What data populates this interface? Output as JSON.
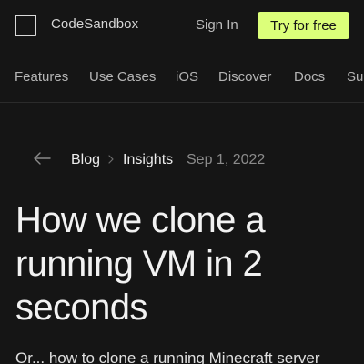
{
  "header": {
    "brand": "CodeSandbox",
    "sign_in": "Sign In",
    "cta": "Try for free",
    "accent": "#dcff7a"
  },
  "nav": {
    "items": [
      {
        "label": "Features"
      },
      {
        "label": "Use Cases"
      },
      {
        "label": "iOS"
      },
      {
        "label": "Discover"
      },
      {
        "label": "Docs"
      },
      {
        "label": "Sup"
      }
    ]
  },
  "breadcrumb": {
    "back_icon": "arrow-left-icon",
    "items": [
      {
        "label": "Blog"
      },
      {
        "label": "Insights"
      }
    ],
    "separator_icon": "chevron-right-icon",
    "date": "Sep 1, 2022"
  },
  "article": {
    "title": "How we clone a running VM in 2 seconds",
    "subtitle": "Or... how to clone a running Minecraft server"
  }
}
